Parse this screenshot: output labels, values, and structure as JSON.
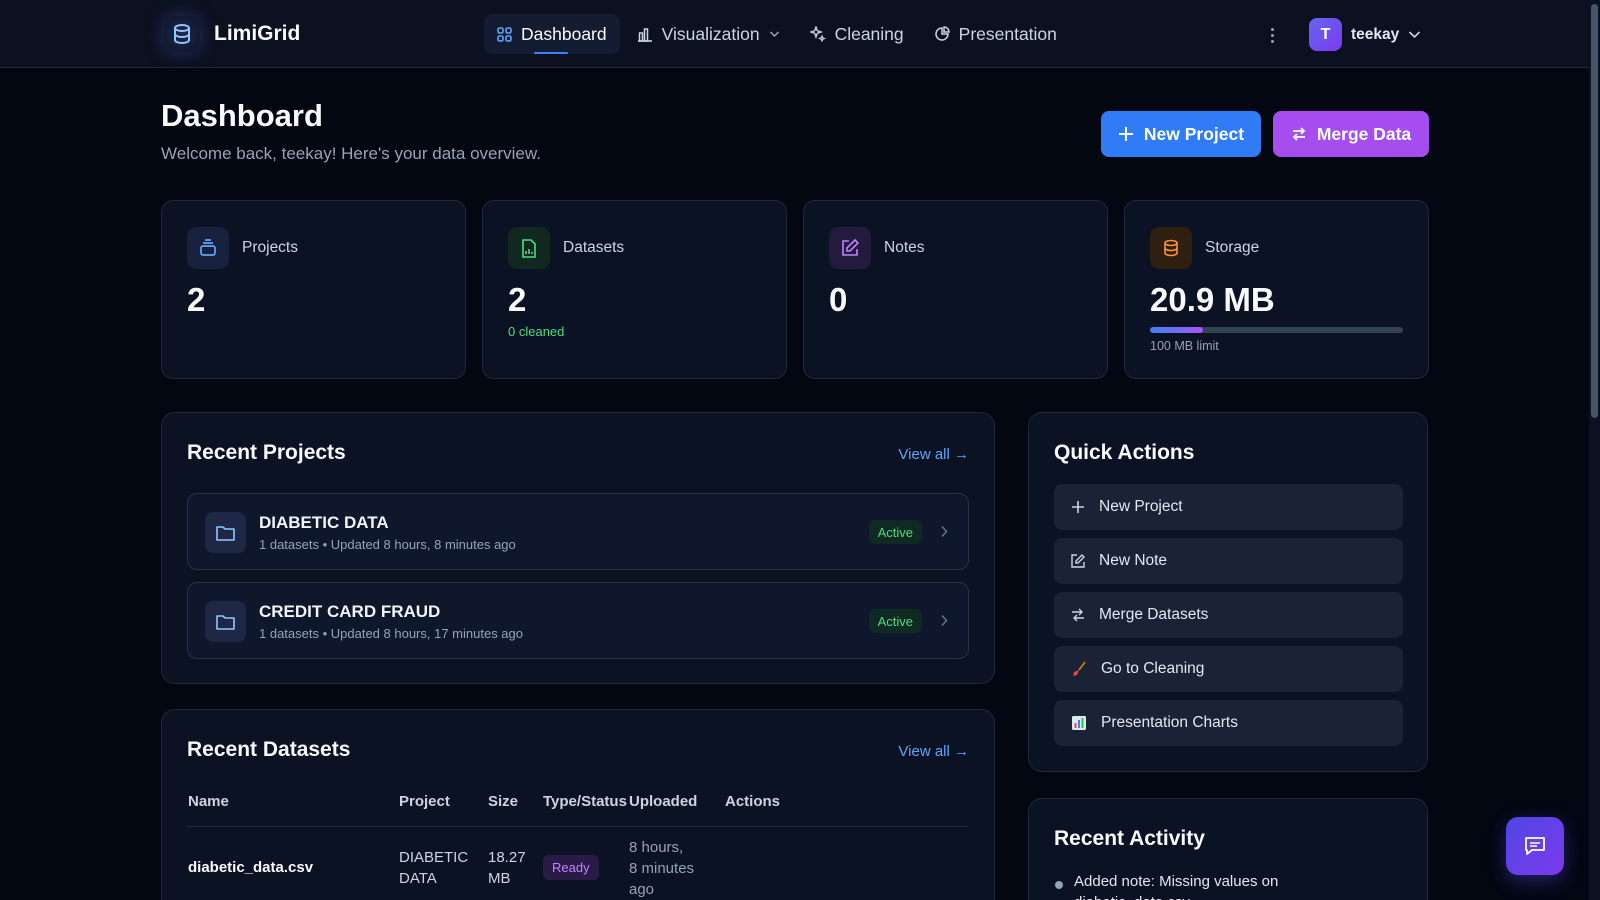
{
  "app": {
    "name": "LimiGrid"
  },
  "nav": {
    "items": [
      {
        "label": "Dashboard",
        "icon": "grid-icon",
        "active": true
      },
      {
        "label": "Visualization",
        "icon": "bar-chart-icon",
        "dropdown": true
      },
      {
        "label": "Cleaning",
        "icon": "sparkles-icon"
      },
      {
        "label": "Presentation",
        "icon": "pie-chart-icon"
      }
    ]
  },
  "user": {
    "initial": "T",
    "name": "teekay"
  },
  "header": {
    "title": "Dashboard",
    "subtitle": "Welcome back, teekay! Here's your data overview.",
    "new_project_label": "New Project",
    "merge_data_label": "Merge Data"
  },
  "stats": {
    "projects": {
      "label": "Projects",
      "value": "2"
    },
    "datasets": {
      "label": "Datasets",
      "value": "2",
      "sub": "0 cleaned"
    },
    "notes": {
      "label": "Notes",
      "value": "0"
    },
    "storage": {
      "label": "Storage",
      "value": "20.9 MB",
      "limit": "100 MB limit",
      "used_fraction": 0.209
    }
  },
  "recent_projects": {
    "title": "Recent Projects",
    "view_all": "View all →",
    "items": [
      {
        "name": "DIABETIC DATA",
        "meta": "1 datasets • Updated 8 hours, 8 minutes ago",
        "status": "Active"
      },
      {
        "name": "CREDIT CARD FRAUD",
        "meta": "1 datasets • Updated 8 hours, 17 minutes ago",
        "status": "Active"
      }
    ]
  },
  "quick_actions": {
    "title": "Quick Actions",
    "items": [
      {
        "label": "New Project",
        "icon": "plus-icon"
      },
      {
        "label": "New Note",
        "icon": "edit-icon"
      },
      {
        "label": "Merge Datasets",
        "icon": "swap-icon"
      },
      {
        "label": "Go to Cleaning",
        "icon": "broom-icon"
      },
      {
        "label": "Presentation Charts",
        "icon": "chart-icon"
      }
    ]
  },
  "recent_datasets": {
    "title": "Recent Datasets",
    "view_all": "View all →",
    "columns": [
      "Name",
      "Project",
      "Size",
      "Type/Status",
      "Uploaded",
      "Actions"
    ],
    "rows": [
      {
        "name": "diabetic_data.csv",
        "project_line1": "DIABETIC",
        "project_line2": "DATA",
        "size_line1": "18.27",
        "size_line2": "MB",
        "status": "Ready",
        "uploaded_line1": "8 hours,",
        "uploaded_line2": "8 minutes",
        "uploaded_line3": "ago"
      }
    ]
  },
  "recent_activity": {
    "title": "Recent Activity",
    "items": [
      {
        "line1": "Added note: Missing values on",
        "line2": "diabetic_data.csv"
      }
    ]
  },
  "colors": {
    "background": "#030712",
    "accent_blue": "#2f7cf6",
    "accent_purple": "#a64df0",
    "success": "#4ade80"
  }
}
